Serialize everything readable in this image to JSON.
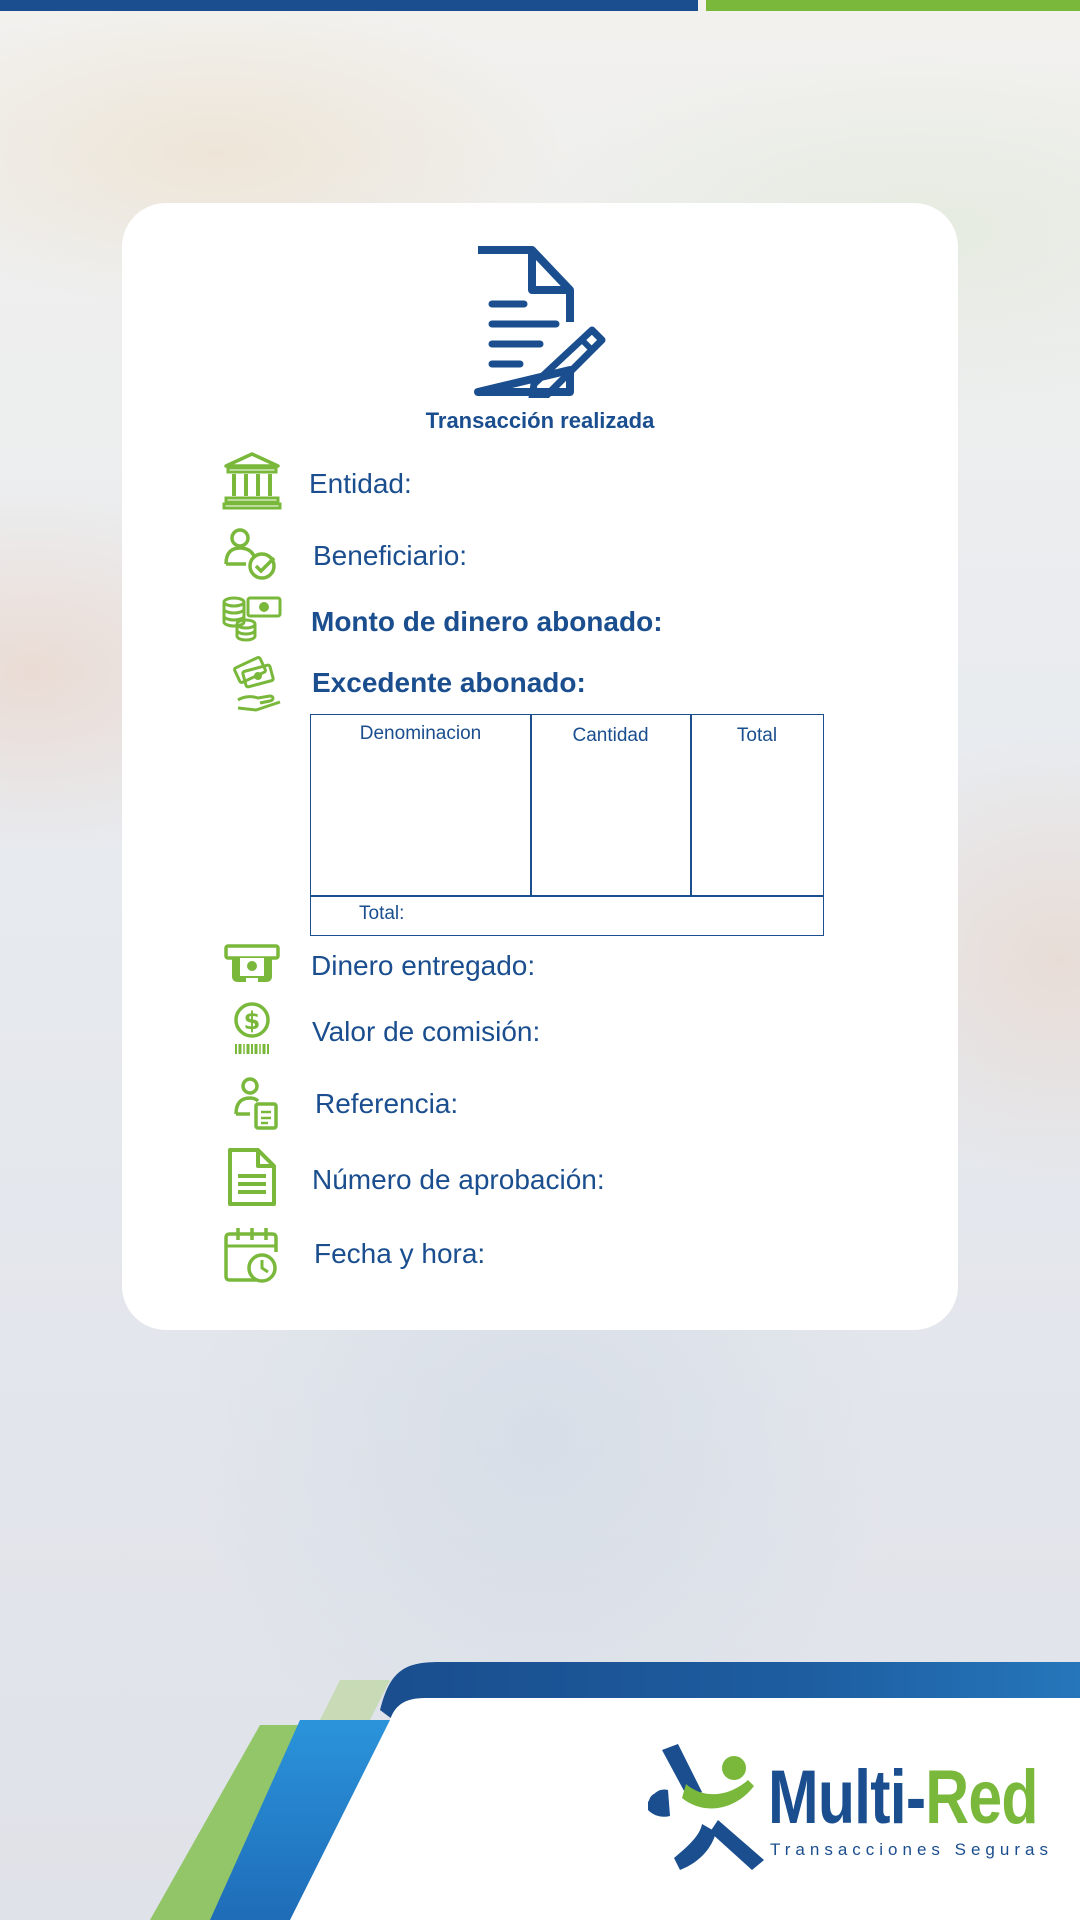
{
  "receipt": {
    "title": "Transacción realizada",
    "fields": {
      "entidad": "Entidad:",
      "beneficiario": "Beneficiario:",
      "monto": "Monto de dinero abonado:",
      "excedente": "Excedente abonado:",
      "dinero_entregado": "Dinero entregado:",
      "comision": "Valor de comisión:",
      "referencia": "Referencia:",
      "aprobacion": "Número de aprobación:",
      "fecha": "Fecha y hora:"
    },
    "table": {
      "headers": [
        "Denominacion",
        "Cantidad",
        "Total"
      ],
      "total_label": "Total:"
    }
  },
  "brand": {
    "name_part1": "Multi-",
    "name_part2": "Red",
    "tagline": "Transacciones Seguras"
  },
  "icons": {
    "document": "document-edit-icon",
    "entidad": "bank-icon",
    "beneficiario": "user-check-icon",
    "monto": "money-coins-icon",
    "excedente": "money-hand-icon",
    "dinero_entregado": "atm-cash-icon",
    "comision": "dollar-coin-icon",
    "referencia": "user-document-icon",
    "aprobacion": "document-icon",
    "fecha": "calendar-clock-icon"
  },
  "colors": {
    "primary_blue": "#1a4e8e",
    "accent_green": "#7ab83c",
    "light_blue": "#2a8fd6"
  }
}
